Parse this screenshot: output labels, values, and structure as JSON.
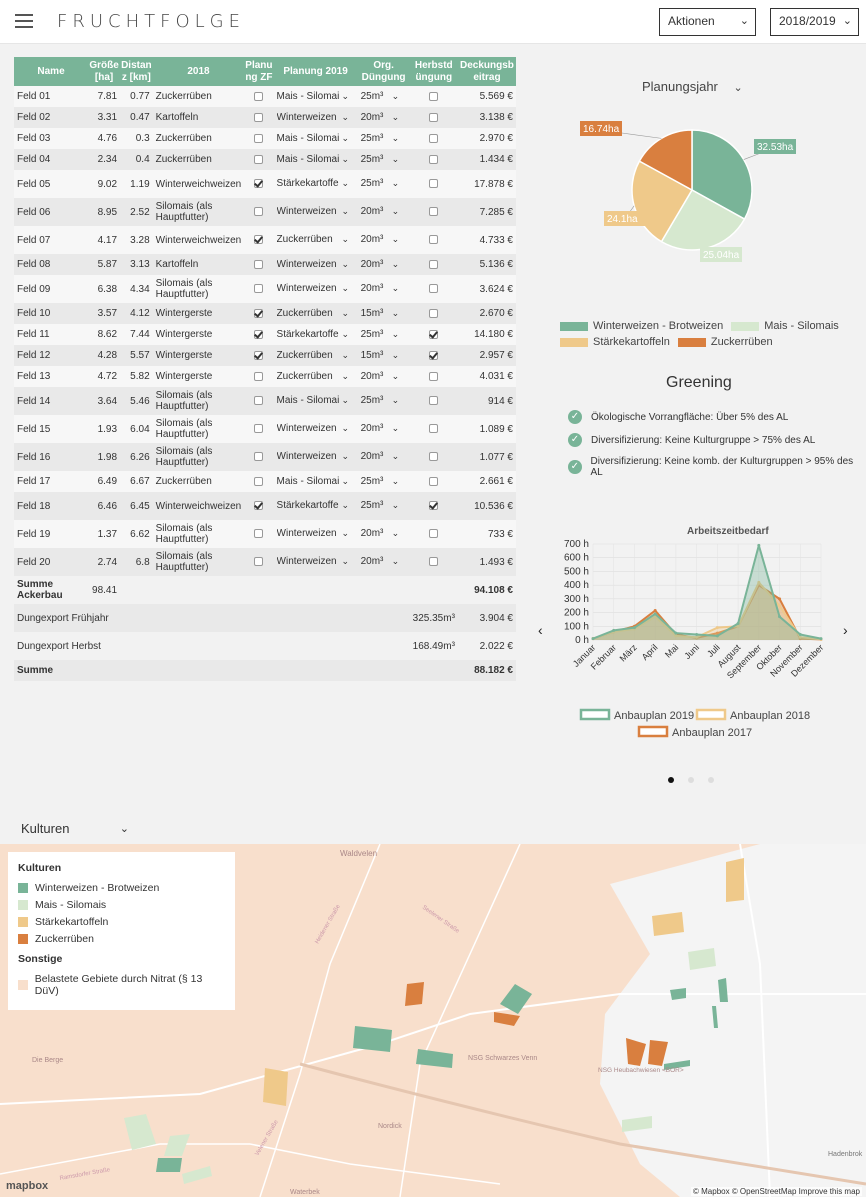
{
  "app": {
    "title": "FRUCHTFOLGE",
    "actions_label": "Aktionen",
    "season": "2018/2019"
  },
  "table": {
    "headers": [
      "Name",
      "Größe [ha]",
      "Distan z [km]",
      "2018",
      "Planu ng ZF",
      "Planung 2019",
      "Org. Düngung",
      "Herbstd üngung",
      "Deckungsb eitrag"
    ],
    "rows": [
      {
        "name": "Feld 01",
        "size": "7.81",
        "dist": "0.77",
        "crop2018": "Zuckerrüben",
        "zf": false,
        "plan2019": "Mais - Silomais",
        "org": "25m³",
        "herbst": false,
        "db": "5.569 €"
      },
      {
        "name": "Feld 02",
        "size": "3.31",
        "dist": "0.47",
        "crop2018": "Kartoffeln",
        "zf": false,
        "plan2019": "Winterweizen",
        "org": "20m³",
        "herbst": false,
        "db": "3.138 €"
      },
      {
        "name": "Feld 03",
        "size": "4.76",
        "dist": "0.3",
        "crop2018": "Zuckerrüben",
        "zf": false,
        "plan2019": "Mais - Silomais",
        "org": "25m³",
        "herbst": false,
        "db": "2.970 €"
      },
      {
        "name": "Feld 04",
        "size": "2.34",
        "dist": "0.4",
        "crop2018": "Zuckerrüben",
        "zf": false,
        "plan2019": "Mais - Silomais",
        "org": "25m³",
        "herbst": false,
        "db": "1.434 €"
      },
      {
        "name": "Feld 05",
        "size": "9.02",
        "dist": "1.19",
        "crop2018": "Winterweichweizen",
        "zf": true,
        "plan2019": "Stärkekartoffeln",
        "org": "25m³",
        "herbst": false,
        "db": "17.878 €"
      },
      {
        "name": "Feld 06",
        "size": "8.95",
        "dist": "2.52",
        "crop2018": "Silomais (als Hauptfutter)",
        "zf": false,
        "plan2019": "Winterweizen",
        "org": "20m³",
        "herbst": false,
        "db": "7.285 €"
      },
      {
        "name": "Feld 07",
        "size": "4.17",
        "dist": "3.28",
        "crop2018": "Winterweichweizen",
        "zf": true,
        "plan2019": "Zuckerrüben",
        "org": "20m³",
        "herbst": false,
        "db": "4.733 €"
      },
      {
        "name": "Feld 08",
        "size": "5.87",
        "dist": "3.13",
        "crop2018": "Kartoffeln",
        "zf": false,
        "plan2019": "Winterweizen",
        "org": "20m³",
        "herbst": false,
        "db": "5.136 €"
      },
      {
        "name": "Feld 09",
        "size": "6.38",
        "dist": "4.34",
        "crop2018": "Silomais (als Hauptfutter)",
        "zf": false,
        "plan2019": "Winterweizen",
        "org": "20m³",
        "herbst": false,
        "db": "3.624 €"
      },
      {
        "name": "Feld 10",
        "size": "3.57",
        "dist": "4.12",
        "crop2018": "Wintergerste",
        "zf": true,
        "plan2019": "Zuckerrüben",
        "org": "15m³",
        "herbst": false,
        "db": "2.670 €"
      },
      {
        "name": "Feld 11",
        "size": "8.62",
        "dist": "7.44",
        "crop2018": "Wintergerste",
        "zf": true,
        "plan2019": "Stärkekartoffeln",
        "org": "25m³",
        "herbst": true,
        "db": "14.180 €"
      },
      {
        "name": "Feld 12",
        "size": "4.28",
        "dist": "5.57",
        "crop2018": "Wintergerste",
        "zf": true,
        "plan2019": "Zuckerrüben",
        "org": "15m³",
        "herbst": true,
        "db": "2.957 €"
      },
      {
        "name": "Feld 13",
        "size": "4.72",
        "dist": "5.82",
        "crop2018": "Wintergerste",
        "zf": false,
        "plan2019": "Zuckerrüben",
        "org": "20m³",
        "herbst": false,
        "db": "4.031 €"
      },
      {
        "name": "Feld 14",
        "size": "3.64",
        "dist": "5.46",
        "crop2018": "Silomais (als Hauptfutter)",
        "zf": false,
        "plan2019": "Mais - Silomais",
        "org": "25m³",
        "herbst": false,
        "db": "914 €"
      },
      {
        "name": "Feld 15",
        "size": "1.93",
        "dist": "6.04",
        "crop2018": "Silomais (als Hauptfutter)",
        "zf": false,
        "plan2019": "Winterweizen",
        "org": "20m³",
        "herbst": false,
        "db": "1.089 €"
      },
      {
        "name": "Feld 16",
        "size": "1.98",
        "dist": "6.26",
        "crop2018": "Silomais (als Hauptfutter)",
        "zf": false,
        "plan2019": "Winterweizen",
        "org": "20m³",
        "herbst": false,
        "db": "1.077 €"
      },
      {
        "name": "Feld 17",
        "size": "6.49",
        "dist": "6.67",
        "crop2018": "Zuckerrüben",
        "zf": false,
        "plan2019": "Mais - Silomais",
        "org": "25m³",
        "herbst": false,
        "db": "2.661 €"
      },
      {
        "name": "Feld 18",
        "size": "6.46",
        "dist": "6.45",
        "crop2018": "Winterweichweizen",
        "zf": true,
        "plan2019": "Stärkekartoffeln",
        "org": "25m³",
        "herbst": true,
        "db": "10.536 €"
      },
      {
        "name": "Feld 19",
        "size": "1.37",
        "dist": "6.62",
        "crop2018": "Silomais (als Hauptfutter)",
        "zf": false,
        "plan2019": "Winterweizen",
        "org": "20m³",
        "herbst": false,
        "db": "733 €"
      },
      {
        "name": "Feld 20",
        "size": "2.74",
        "dist": "6.8",
        "crop2018": "Silomais (als Hauptfutter)",
        "zf": false,
        "plan2019": "Winterweizen",
        "org": "20m³",
        "herbst": false,
        "db": "1.493 €"
      }
    ],
    "summe_ackerbau": {
      "label": "Summe Ackerbau",
      "size": "98.41",
      "db": "94.108 €"
    },
    "export_fruehjahr": {
      "label": "Dungexport Frühjahr",
      "amount": "325.35m³",
      "db": "3.904 €"
    },
    "export_herbst": {
      "label": "Dungexport Herbst",
      "amount": "168.49m³",
      "db": "2.022 €"
    },
    "summe": {
      "label": "Summe",
      "db": "88.182 €"
    }
  },
  "planungsjahr_label": "Planungsjahr",
  "pie": {
    "labels": [
      "32.53ha",
      "25.04ha",
      "24.1ha",
      "16.74ha"
    ],
    "legend": [
      "Winterweizen - Brotweizen",
      "Mais - Silomais",
      "Stärkekartoffeln",
      "Zuckerrüben"
    ],
    "colors": [
      "#79b498",
      "#d6e8cf",
      "#efc98a",
      "#d97f3f"
    ]
  },
  "greening": {
    "title": "Greening",
    "items": [
      "Ökologische Vorrangfläche: Über 5% des AL",
      "Diversifizierung: Keine Kulturgruppe > 75% des AL",
      "Diversifizierung: Keine komb. der Kulturgruppen > 95% des AL"
    ]
  },
  "chart_data": [
    {
      "type": "pie",
      "title": "",
      "categories": [
        "Winterweizen - Brotweizen",
        "Mais - Silomais",
        "Stärkekartoffeln",
        "Zuckerrüben"
      ],
      "values": [
        32.53,
        25.04,
        24.1,
        16.74
      ],
      "unit": "ha",
      "legend_position": "bottom"
    },
    {
      "type": "area",
      "title": "Arbeitszeitbedarf",
      "categories": [
        "Januar",
        "Februar",
        "März",
        "April",
        "Mai",
        "Juni",
        "Juli",
        "August",
        "September",
        "Oktober",
        "November",
        "Dezember"
      ],
      "yticks": [
        "0 h",
        "100 h",
        "200 h",
        "300 h",
        "400 h",
        "500 h",
        "600 h",
        "700 h"
      ],
      "ylim": [
        0,
        700
      ],
      "grid": true,
      "legend_position": "bottom",
      "series": [
        {
          "name": "Anbauplan 2019",
          "color": "#79b498",
          "values": [
            10,
            70,
            90,
            190,
            50,
            40,
            30,
            120,
            690,
            170,
            40,
            10
          ]
        },
        {
          "name": "Anbauplan 2018",
          "color": "#efc98a",
          "values": [
            10,
            60,
            80,
            170,
            30,
            20,
            90,
            100,
            420,
            250,
            20,
            5
          ]
        },
        {
          "name": "Anbauplan 2017",
          "color": "#d97f3f",
          "values": [
            10,
            60,
            100,
            215,
            40,
            15,
            50,
            100,
            400,
            300,
            10,
            5
          ]
        }
      ]
    }
  ],
  "map": {
    "selector": "Kulturen",
    "legend_title": "Kulturen",
    "legend_items": [
      {
        "label": "Winterweizen - Brotweizen",
        "color": "#79b498"
      },
      {
        "label": "Mais - Silomais",
        "color": "#d6e8cf"
      },
      {
        "label": "Stärkekartoffeln",
        "color": "#efc98a"
      },
      {
        "label": "Zuckerrüben",
        "color": "#d97f3f"
      }
    ],
    "other_title": "Sonstige",
    "other_items": [
      {
        "label": "Belastete Gebiete durch Nitrat (§ 13 DüV)",
        "color": "#f8dfcc"
      }
    ],
    "place_labels": [
      "Waldvelen",
      "Die Berge",
      "Nordick",
      "NSG Schwarzes Venn",
      "NSG Heubachwiesen <BOR>",
      "Hadenbrok",
      "Waterbek",
      "Heidener Straße",
      "Ramsdorfer Straße",
      "Velener Straße",
      "Seelener Straße"
    ],
    "attribution": "© Mapbox © OpenStreetMap  Improve this map",
    "logo": "mapbox"
  }
}
